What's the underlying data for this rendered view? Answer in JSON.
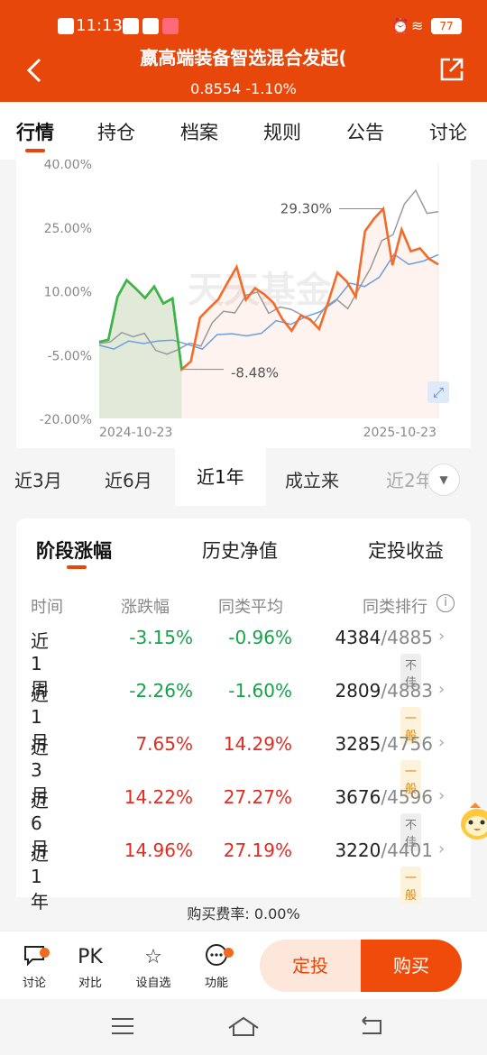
{
  "status_bar": {
    "time": "11:13",
    "battery": "77"
  },
  "header": {
    "title": "嬴高端装备智选混合发起(",
    "nav_value": "0.8554",
    "change": "-1.10%"
  },
  "tabs": [
    "行情",
    "持仓",
    "档案",
    "规则",
    "公告",
    "讨论"
  ],
  "chart": {
    "watermark": "天天基金",
    "y_tick_labels": [
      "40.00%",
      "25.00%",
      "10.00%",
      "-5.00%",
      "-20.00%"
    ],
    "x_tick_labels": [
      "2024-10-23",
      "2025-10-23"
    ],
    "max_annotation": "29.30%",
    "min_annotation": "-8.48%"
  },
  "chart_data": {
    "type": "line",
    "ylim": [
      -20,
      40
    ],
    "x_labels": [
      "2024-10-23",
      "2025-10-23"
    ],
    "series": [
      {
        "color": "#f26b2a",
        "values": [
          -2.0,
          -1.5,
          8.6,
          12.5,
          10.5,
          8.3,
          11.0,
          7.0,
          8.2,
          -8.48,
          -6.6,
          3.7,
          5.9,
          8.0,
          11.9,
          15.6,
          7.9,
          10.6,
          9.2,
          7.2,
          3.3,
          0.6,
          4.2,
          3.3,
          1.0,
          7.4,
          14.3,
          12.2,
          8.6,
          24.0,
          27.0,
          29.3,
          16.0,
          24.4,
          19.3,
          20.0,
          17.5,
          16.2
        ]
      },
      {
        "color": "#9a9a9a",
        "values": [
          -2.4,
          -2.0,
          0.2,
          -0.8,
          0.0,
          -4.0,
          -4.9,
          -3.8,
          -2.3,
          -3.0,
          2.5,
          5.2,
          4.8,
          9.0,
          9.7,
          4.7,
          6.2,
          5.6,
          4.2,
          2.4,
          6.2,
          8.0,
          5.8,
          10.6,
          15.3,
          21.8,
          23.2,
          30.4,
          33.6,
          28.2,
          28.6
        ]
      },
      {
        "color": "#6a9fe0",
        "values": [
          -2.8,
          -3.7,
          -1.8,
          -2.4,
          -1.8,
          -1.6,
          -2.6,
          -3.7,
          -0.3,
          -0.1,
          -0.6,
          0.0,
          3.0,
          2.1,
          3.9,
          5.1,
          7.5,
          11.8,
          11.0,
          13.2,
          18.6,
          16.2,
          17.0,
          18.5
        ]
      }
    ],
    "green_segment_values": [
      -2.0,
      -1.5,
      8.6,
      12.5,
      10.5,
      8.3,
      11.0,
      7.0,
      8.2,
      -8.48
    ]
  },
  "periods": [
    "近3月",
    "近6月",
    "近1年",
    "成立来",
    "近2年"
  ],
  "returns": {
    "tabs": [
      "阶段涨幅",
      "历史净值",
      "定投收益"
    ],
    "headers": [
      "时间",
      "涨跌幅",
      "同类平均",
      "同类排行"
    ],
    "rows": [
      {
        "period": "近1周",
        "change": "-3.15%",
        "avg": "-0.96%",
        "rank": "4384",
        "total": "/4885",
        "badge": "不佳"
      },
      {
        "period": "近1月",
        "change": "-2.26%",
        "avg": "-1.60%",
        "rank": "2809",
        "total": "/4883",
        "badge": "一般"
      },
      {
        "period": "近3月",
        "change": "7.65%",
        "avg": "14.29%",
        "rank": "3285",
        "total": "/4756",
        "badge": "一般"
      },
      {
        "period": "近6月",
        "change": "14.22%",
        "avg": "27.27%",
        "rank": "3676",
        "total": "/4596",
        "badge": "不佳"
      },
      {
        "period": "近1年",
        "change": "14.96%",
        "avg": "27.19%",
        "rank": "3220",
        "total": "/4401",
        "badge": "一般"
      }
    ]
  },
  "fee": "购买费率: 0.00%",
  "bottom_bar": {
    "items": [
      {
        "label": "讨论",
        "icon": "chat-icon"
      },
      {
        "label": "对比",
        "icon": "pk-icon",
        "glyph": "PK"
      },
      {
        "label": "设自选",
        "icon": "star-add-icon"
      },
      {
        "label": "功能",
        "icon": "more-icon"
      }
    ],
    "dingtou": "定投",
    "buy": "购买"
  }
}
